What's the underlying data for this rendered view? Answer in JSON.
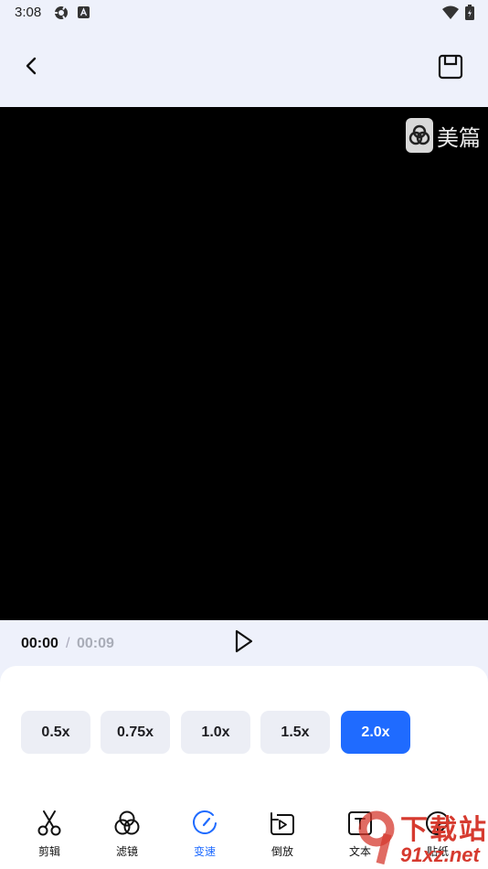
{
  "status_bar": {
    "time": "3:08",
    "icons": [
      "settings-cog-icon",
      "a-box-icon",
      "wifi-icon",
      "battery-icon"
    ]
  },
  "header": {
    "back_icon": "chevron-left-icon",
    "save_icon": "save-icon"
  },
  "video": {
    "watermark_text": "美篇"
  },
  "playback": {
    "current_time": "00:00",
    "separator": "/",
    "total_time": "00:09",
    "play_icon": "play-icon"
  },
  "speed_options": [
    {
      "label": "0.5x",
      "selected": false
    },
    {
      "label": "0.75x",
      "selected": false
    },
    {
      "label": "1.0x",
      "selected": false
    },
    {
      "label": "1.5x",
      "selected": false
    },
    {
      "label": "2.0x",
      "selected": true
    }
  ],
  "tools": [
    {
      "label": "剪辑",
      "icon": "scissors-icon",
      "active": false
    },
    {
      "label": "滤镜",
      "icon": "filter-icon",
      "active": false
    },
    {
      "label": "变速",
      "icon": "speed-icon",
      "active": true
    },
    {
      "label": "倒放",
      "icon": "reverse-play-icon",
      "active": false
    },
    {
      "label": "文本",
      "icon": "text-icon",
      "active": false
    },
    {
      "label": "贴纸",
      "icon": "sticker-icon",
      "active": false
    }
  ],
  "site_watermark": {
    "top_text": "下载站",
    "bottom_text": "91xz.net"
  },
  "colors": {
    "accent": "#1f6bff",
    "header_bg": "#eef1fb",
    "video_bg": "#000000",
    "chip_bg": "#eceef5"
  }
}
